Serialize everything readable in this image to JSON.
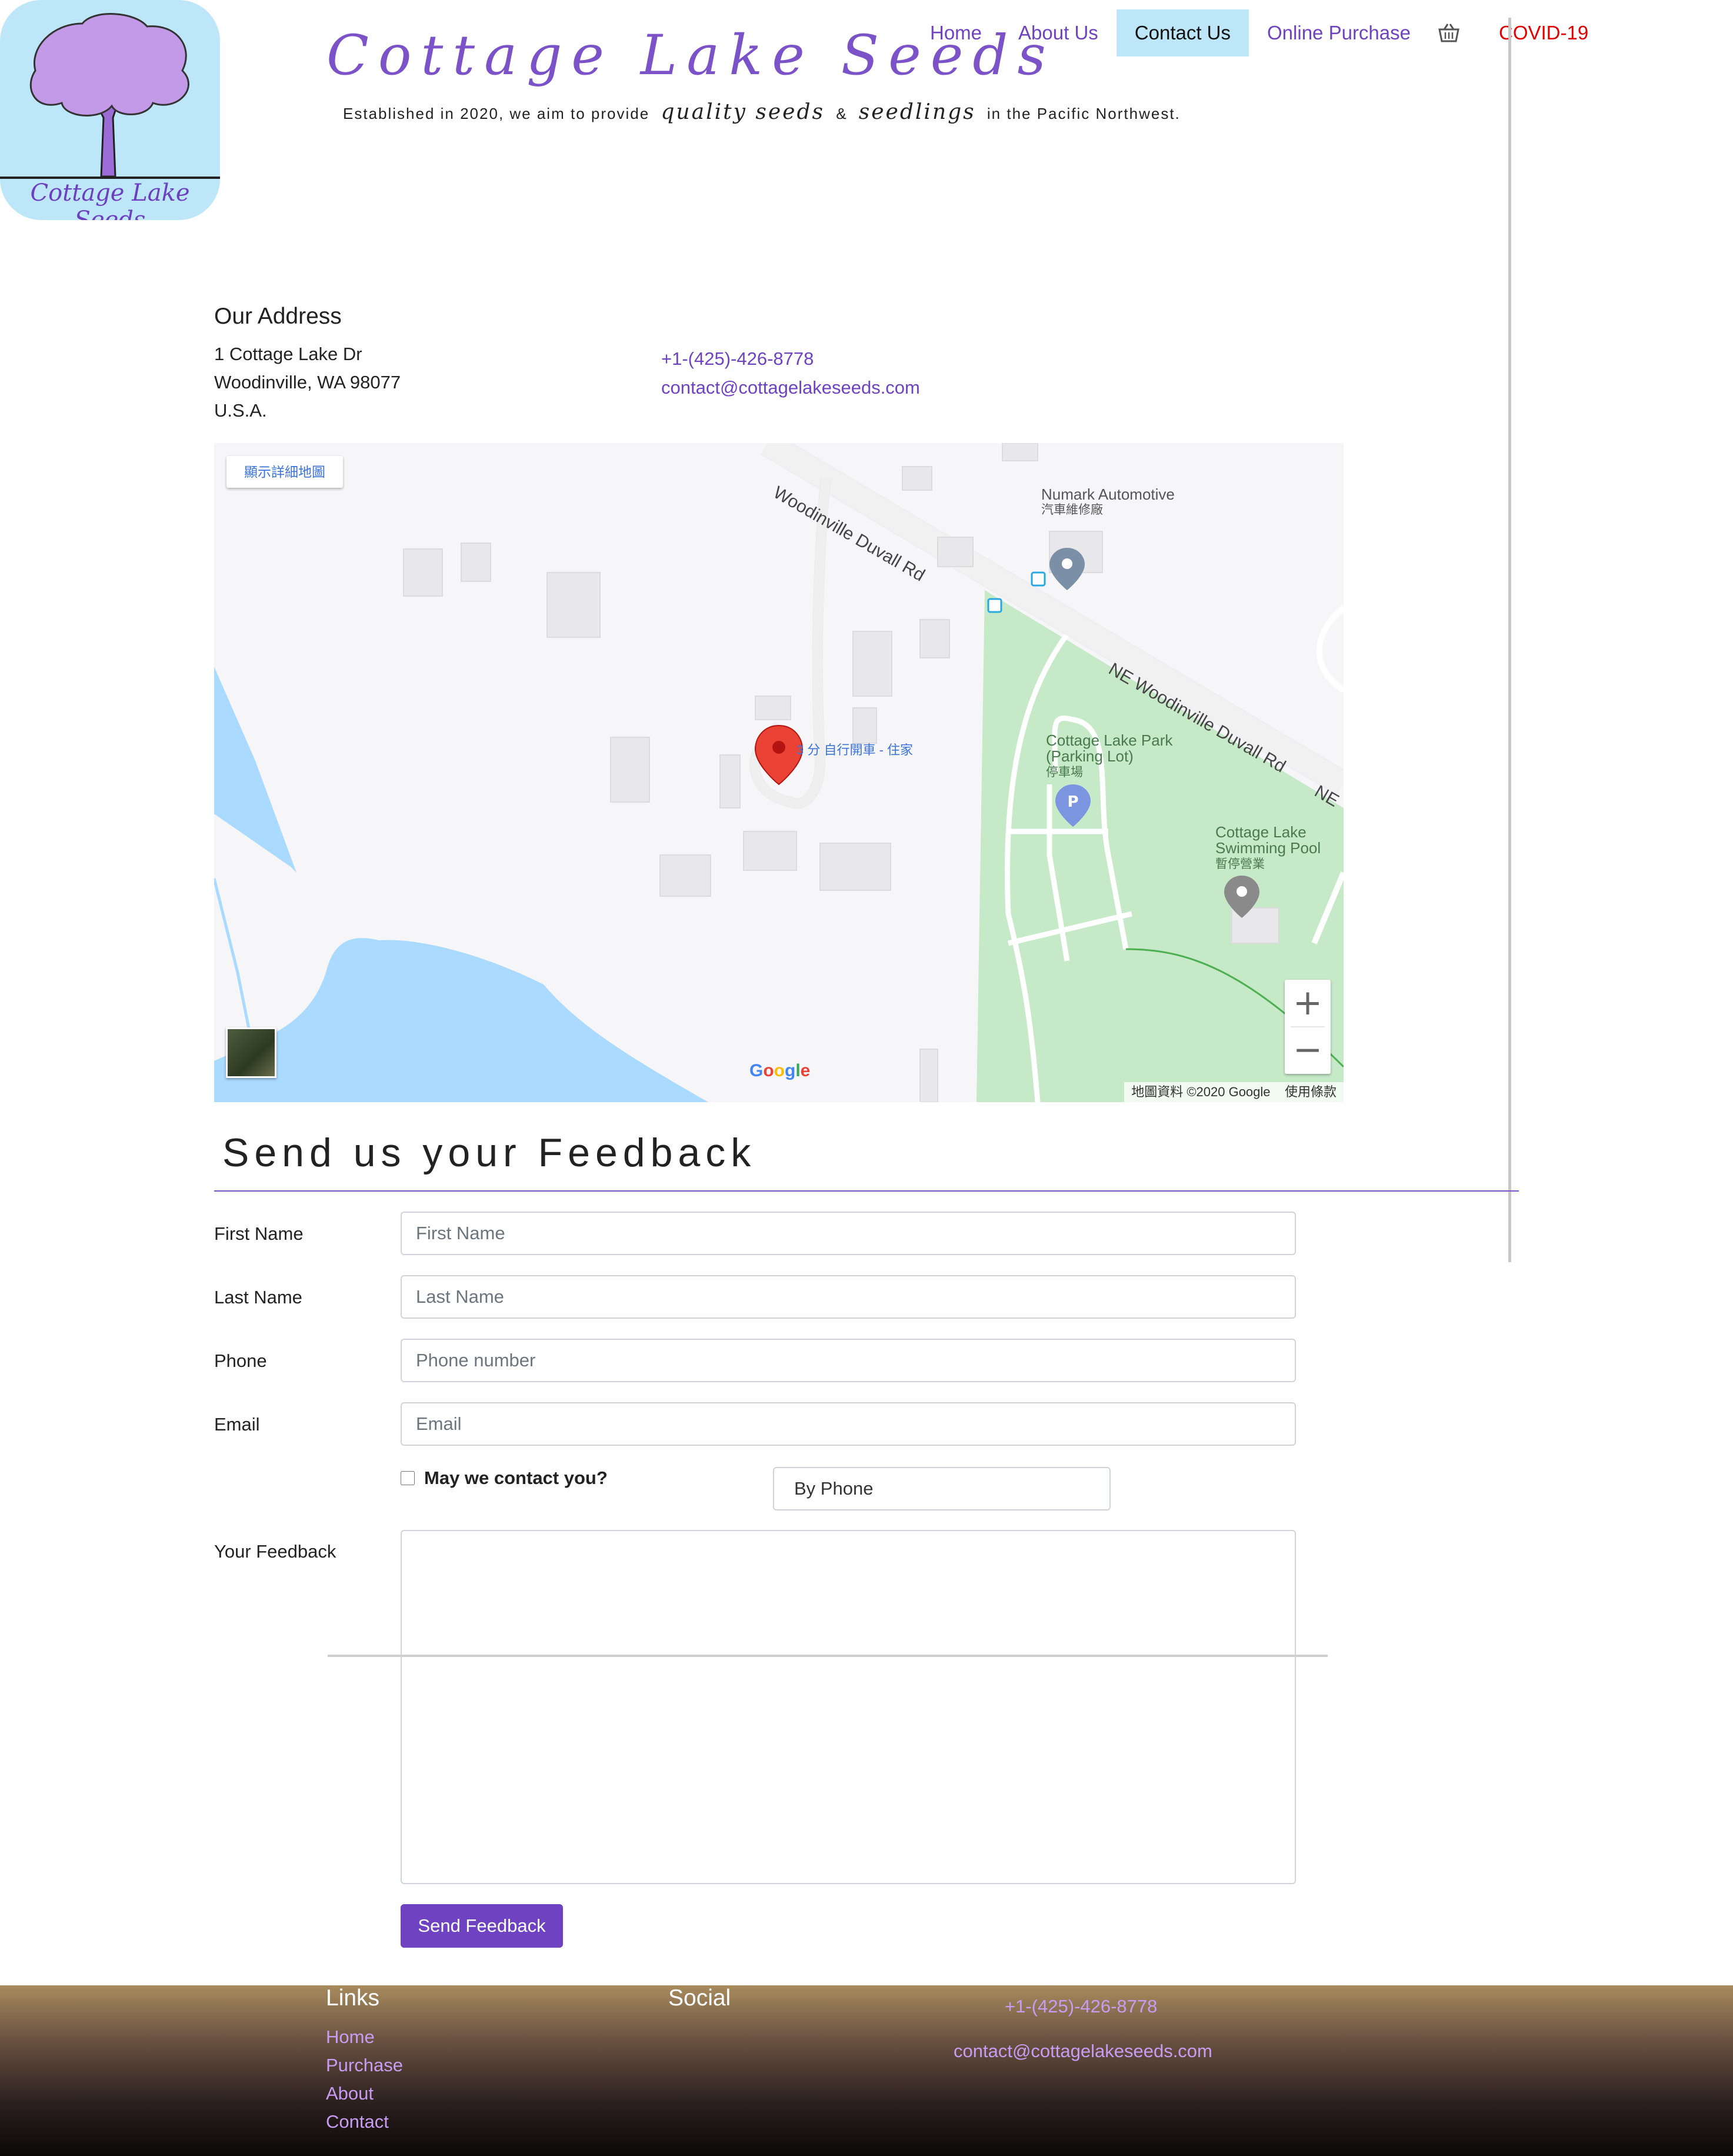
{
  "header": {
    "logo_text": "Cottage Lake Seeds",
    "site_title": "Cottage Lake Seeds",
    "tagline_part1": "Established in 2020, we aim to provide",
    "tagline_cursive1": "quality seeds",
    "tagline_amp": "&",
    "tagline_cursive2": "seedlings",
    "tagline_part2": "in the Pacific Northwest."
  },
  "nav": {
    "items": [
      {
        "label": "Home"
      },
      {
        "label": "About Us"
      },
      {
        "label": "Contact Us",
        "active": true
      },
      {
        "label": "Online Purchase"
      }
    ],
    "cart_icon": "shopping-basket-icon",
    "covid": "COVID-19"
  },
  "address": {
    "title": "Our Address",
    "lines": [
      "1 Cottage Lake Dr",
      "Woodinville, WA 98077",
      "U.S.A."
    ],
    "phone": "+1-(425)-426-8778",
    "email": "contact@cottagelakeseeds.com"
  },
  "map": {
    "detail_button": "顯示詳細地圖",
    "road_1": "Woodinville Duvall Rd",
    "road_2": "NE Woodinville Duvall Rd",
    "road_3": "NE",
    "poi_automotive": "Numark Automotive",
    "poi_automotive_sub": "汽車維修廠",
    "poi_park_1": "Cottage Lake Park",
    "poi_park_2": "(Parking Lot)",
    "poi_park_sub": "停車場",
    "poi_pool_1": "Cottage Lake",
    "poi_pool_2": "Swimming Pool",
    "poi_pool_sub": "暫停營業",
    "pin_label": "3 分 自行開車 - 住家",
    "zoom_in": "+",
    "zoom_out": "−",
    "google": "Google",
    "copyright": "地圖資料 ©2020 Google",
    "terms": "使用條款",
    "colors": {
      "water": "#aadaff",
      "park": "#c6e9c8",
      "land": "#f6f6f8",
      "pin": "#ea4335"
    }
  },
  "feedback": {
    "title": "Send us your Feedback",
    "fields": {
      "first_name_label": "First Name",
      "first_name_placeholder": "First Name",
      "last_name_label": "Last Name",
      "last_name_placeholder": "Last Name",
      "phone_label": "Phone",
      "phone_placeholder": "Phone number",
      "email_label": "Email",
      "email_placeholder": "Email"
    },
    "contact_checkbox_label": "May we contact you?",
    "contact_checked": false,
    "contact_method": "By Phone",
    "feedback_label": "Your Feedback",
    "feedback_value": "",
    "send_button": "Send Feedback"
  },
  "footer": {
    "links_heading": "Links",
    "links": [
      "Home",
      "Purchase",
      "About",
      "Contact"
    ],
    "social_heading": "Social",
    "phone": "+1-(425)-426-8778",
    "email": "contact@cottagelakeseeds.com"
  },
  "colors": {
    "accent": "#6f42c1",
    "active_bg": "#bde7f9",
    "covid": "#e00000"
  }
}
